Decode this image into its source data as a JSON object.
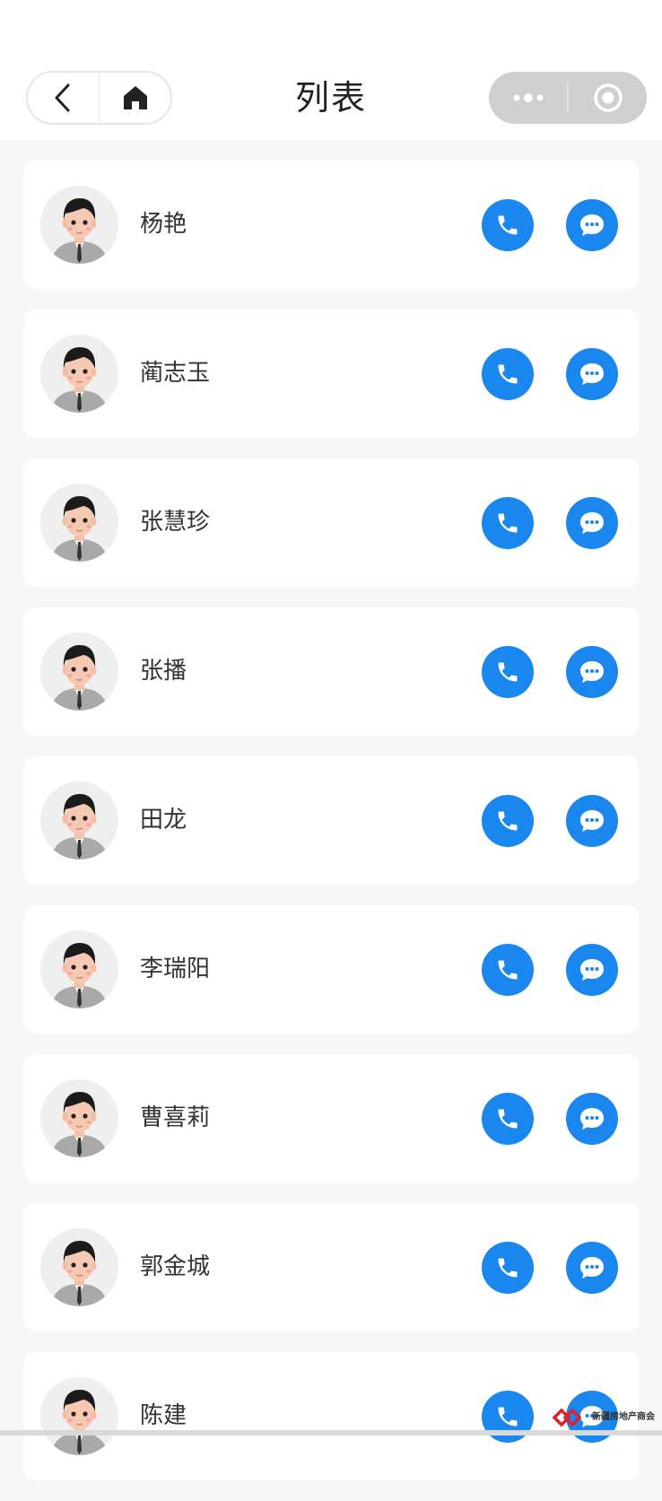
{
  "header": {
    "title": "列表",
    "back_icon": "chevron-left-icon",
    "home_icon": "home-icon",
    "more_icon": "more-dots-icon",
    "close_icon": "target-circle-icon"
  },
  "contacts": [
    {
      "name": "杨艳"
    },
    {
      "name": "蔺志玉"
    },
    {
      "name": "张慧珍"
    },
    {
      "name": "张播"
    },
    {
      "name": "田龙"
    },
    {
      "name": "李瑞阳"
    },
    {
      "name": "曹喜莉"
    },
    {
      "name": "郭金城"
    },
    {
      "name": "陈建"
    }
  ],
  "watermark": {
    "text": "新疆房地产商会"
  },
  "colors": {
    "accent": "#1a87ee",
    "background": "#f7f7f7",
    "card": "#ffffff"
  }
}
